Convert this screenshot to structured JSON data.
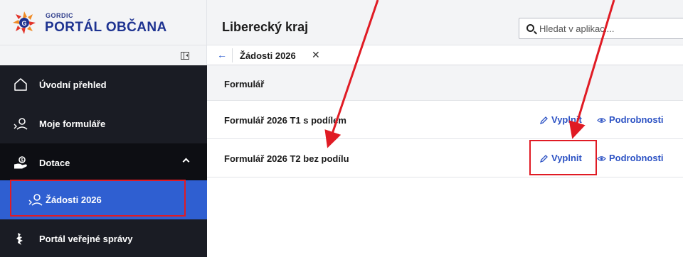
{
  "brand": {
    "small": "GORDIC",
    "title": "PORTÁL OBČANA"
  },
  "sidebar": {
    "collapse_icon": "collapse-sidebar-icon",
    "items": [
      {
        "label": "Úvodní přehled",
        "icon": "home-icon"
      },
      {
        "label": "Moje formuláře",
        "icon": "person-form-icon"
      },
      {
        "label": "Dotace",
        "icon": "hand-coin-icon"
      },
      {
        "label": "Žádosti 2026",
        "icon": "person-form-icon"
      },
      {
        "label": "Portál veřejné správy",
        "icon": "coat-of-arms-icon"
      }
    ]
  },
  "header": {
    "title": "Liberecký kraj"
  },
  "search": {
    "placeholder": "Hledat v aplikaci..."
  },
  "tab": {
    "label": "Žádosti 2026",
    "back_icon": "←",
    "close_icon": "✕"
  },
  "list": {
    "header": "Formulář",
    "rows": [
      {
        "name": "Formulář 2026 T1 s podílem",
        "fill": "Vyplnit",
        "details": "Podrobnosti"
      },
      {
        "name": "Formulář 2026 T2 bez podílu",
        "fill": "Vyplnit",
        "details": "Podrobnosti"
      }
    ]
  },
  "colors": {
    "nav_bg": "#1a1c24",
    "active": "#2f5fd1",
    "link": "#2c52c4",
    "annotation": "#e01b24"
  }
}
